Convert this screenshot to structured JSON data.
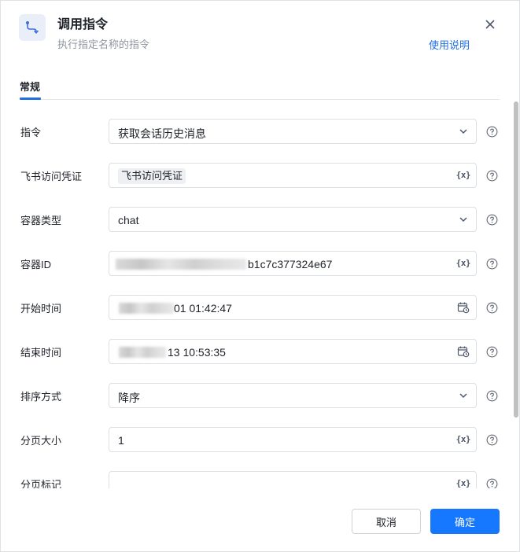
{
  "header": {
    "title": "调用指令",
    "subtitle": "执行指定名称的指令",
    "help_link": "使用说明",
    "icon": "flow-branch-icon",
    "close_icon": "close-icon"
  },
  "tabs": [
    {
      "label": "常规",
      "active": true
    }
  ],
  "fields": [
    {
      "label": "指令",
      "value": "获取会话历史消息",
      "type": "select"
    },
    {
      "label": "飞书访问凭证",
      "value": "飞书访问凭证",
      "type": "variable-chip"
    },
    {
      "label": "容器类型",
      "value": "chat",
      "type": "select"
    },
    {
      "label": "容器ID",
      "value": "b1c7c377324e67",
      "type": "variable"
    },
    {
      "label": "开始时间",
      "value": "01 01:42:47",
      "type": "datetime"
    },
    {
      "label": "结束时间",
      "value": "13 10:53:35",
      "type": "datetime"
    },
    {
      "label": "排序方式",
      "value": "降序",
      "type": "select"
    },
    {
      "label": "分页大小",
      "value": "1",
      "type": "variable"
    },
    {
      "label": "分页标记",
      "value": "",
      "type": "variable"
    }
  ],
  "variable_icon_text": "{x}",
  "footer": {
    "cancel": "取消",
    "confirm": "确定"
  },
  "colors": {
    "primary": "#1677ff",
    "link": "#1f6fe0",
    "border": "#dcdfe6"
  }
}
